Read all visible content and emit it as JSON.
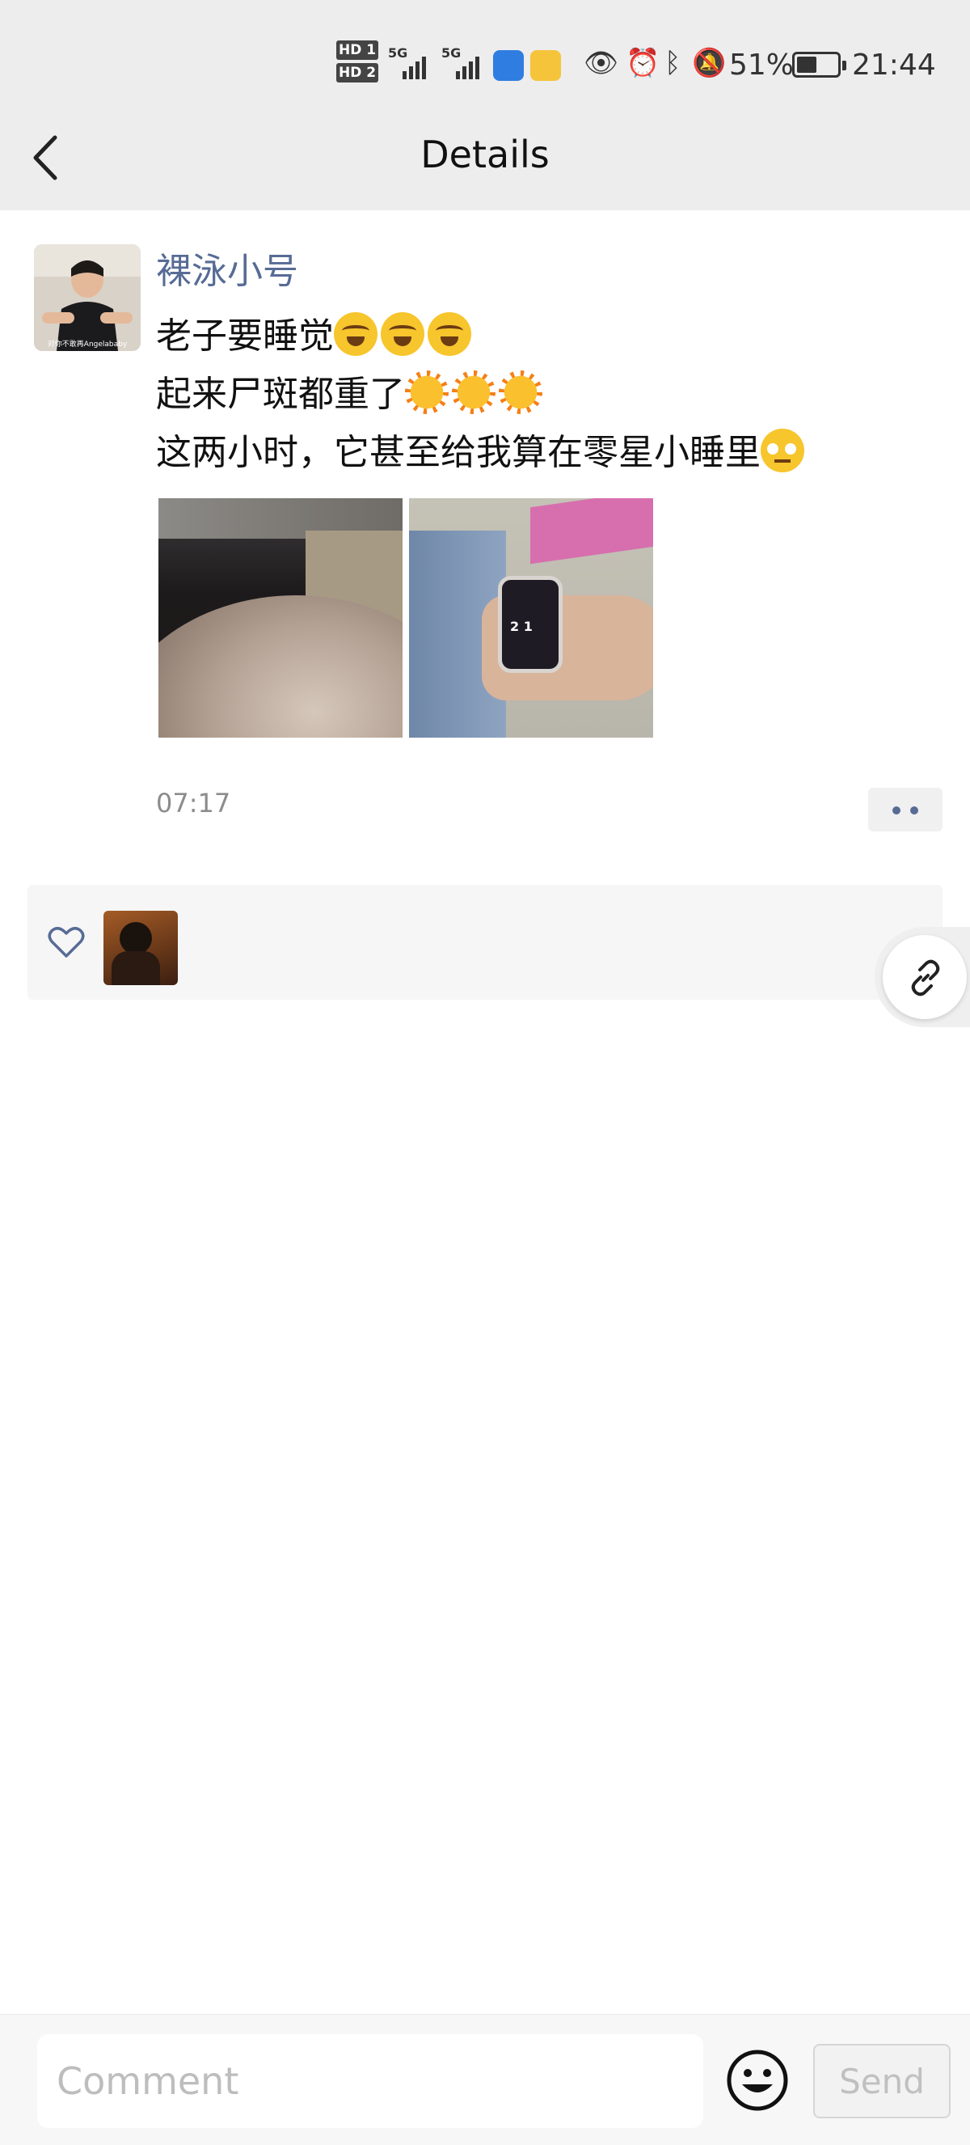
{
  "status_bar": {
    "hd1": "HD 1",
    "hd2": "HD 2",
    "net1": "5G",
    "net2": "5G",
    "battery_percent": "51%",
    "battery_level": 0.51,
    "time": "21:44",
    "icons": [
      "weather-app-icon",
      "weibo-app-icon",
      "eye-icon",
      "alarm-icon",
      "bluetooth-icon",
      "mute-icon"
    ]
  },
  "header": {
    "title": "Details"
  },
  "post": {
    "author": "裸泳小号",
    "lines": [
      {
        "text": "老子要睡觉",
        "emoji": [
          "cry",
          "cry",
          "cry"
        ]
      },
      {
        "text": "起来尸斑都重了",
        "emoji": [
          "sun",
          "sun",
          "sun"
        ]
      },
      {
        "text": "这两小时，它甚至给我算在零星小睡里",
        "emoji": [
          "roll"
        ]
      }
    ],
    "avatar_caption": "对你不敢再Angelababy",
    "photos": [
      "hair-photo",
      "smartwatch-photo"
    ],
    "time": "07:17"
  },
  "comment_bar": {
    "placeholder": "Comment",
    "send_label": "Send"
  },
  "colors": {
    "author_link": "#576b95",
    "header_bg": "#ededed",
    "likes_bg": "#f6f6f6"
  }
}
